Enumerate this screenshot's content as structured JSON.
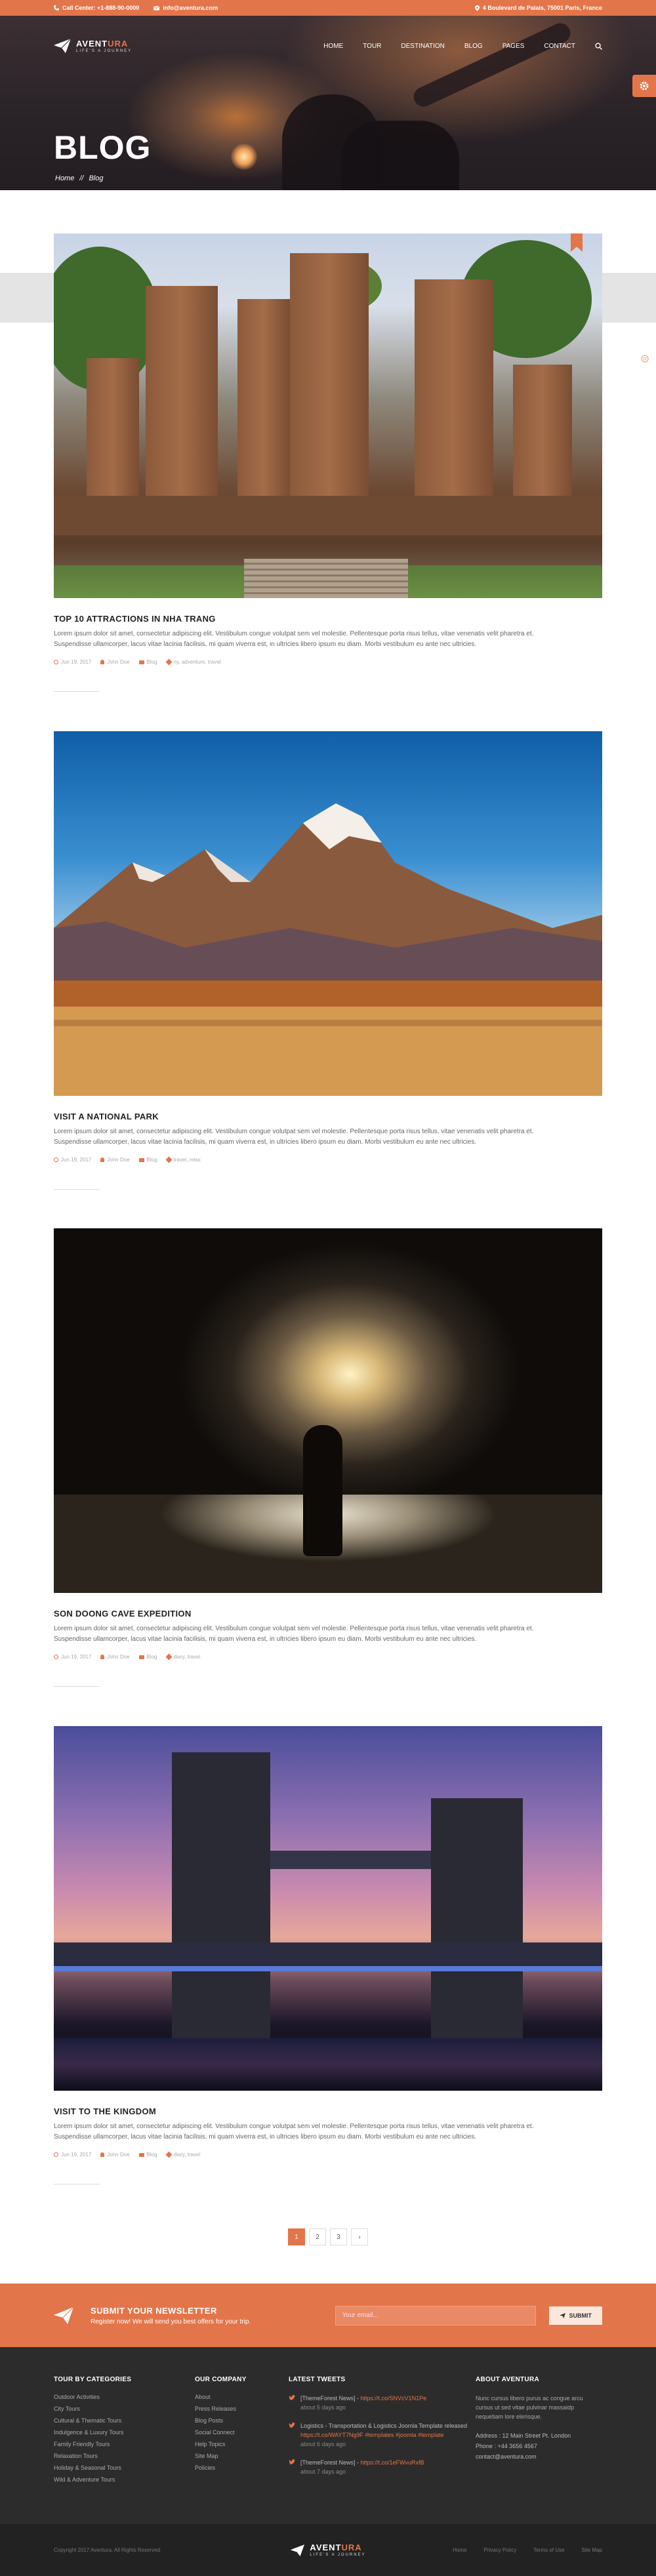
{
  "topbar": {
    "call_label": "Call Center: +1-888-90-0000",
    "email": "info@aventura.com",
    "address": "4 Boulevard de Palais, 75001 Paris, France"
  },
  "header": {
    "logo_name_1": "AVENT",
    "logo_name_2": "URA",
    "logo_tagline": "LIFE'S A JOURNEY",
    "nav": [
      "HOME",
      "TOUR",
      "DESTINATION",
      "BLOG",
      "PAGES",
      "CONTACT"
    ]
  },
  "hero": {
    "title": "BLOG",
    "breadcrumb": [
      "Home",
      "//",
      "Blog"
    ]
  },
  "posts": [
    {
      "title": "TOP 10 ATTRACTIONS IN NHA TRANG",
      "excerpt": "Lorem ipsum dolor sit amet, consectetur adipiscing elit. Vestibulum congue volutpat sem vel molestie. Pellentesque porta risus tellus, vitae venenatis velit pharetra et. Suspendisse ullamcorper, lacus vitae lacinia facilisis, mi quam viverra est, in ultricies libero ipsum eu diam. Morbi vestibulum eu ante nec ultricies.",
      "date": "Jun 19, 2017",
      "author": "John Doe",
      "category": "Blog",
      "tags": "ny, adventure, travel"
    },
    {
      "title": "VISIT A NATIONAL PARK",
      "excerpt": "Lorem ipsum dolor sit amet, consectetur adipiscing elit. Vestibulum congue volutpat sem vel molestie. Pellentesque porta risus tellus, vitae venenatis velit pharetra et. Suspendisse ullamcorper, lacus vitae lacinia facilisis, mi quam viverra est, in ultricies libero ipsum eu diam. Morbi vestibulum eu ante nec ultricies.",
      "date": "Jun 19, 2017",
      "author": "John Doe",
      "category": "Blog",
      "tags": "travel, relax"
    },
    {
      "title": "SON DOONG CAVE EXPEDITION",
      "excerpt": "Lorem ipsum dolor sit amet, consectetur adipiscing elit. Vestibulum congue volutpat sem vel molestie. Pellentesque porta risus tellus, vitae venenatis velit pharetra et. Suspendisse ullamcorper, lacus vitae lacinia facilisis, mi quam viverra est, in ultricies libero ipsum eu diam. Morbi vestibulum eu ante nec ultricies.",
      "date": "Jun 19, 2017",
      "author": "John Doe",
      "category": "Blog",
      "tags": "diary, travel"
    },
    {
      "title": "VISIT TO THE KINGDOM",
      "excerpt": "Lorem ipsum dolor sit amet, consectetur adipiscing elit. Vestibulum congue volutpat sem vel molestie. Pellentesque porta risus tellus, vitae venenatis velit pharetra et. Suspendisse ullamcorper, lacus vitae lacinia facilisis, mi quam viverra est, in ultricies libero ipsum eu diam. Morbi vestibulum eu ante nec ultricies.",
      "date": "Jun 19, 2017",
      "author": "John Doe",
      "category": "Blog",
      "tags": "diary, travel"
    }
  ],
  "pagination": {
    "pages": [
      "1",
      "2",
      "3"
    ],
    "next": "›",
    "active": "1"
  },
  "newsletter": {
    "title": "SUBMIT YOUR NEWSLETTER",
    "subtitle": "Register now! We will send you best offers for your trip.",
    "placeholder": "Your email...",
    "button": "SUBMIT"
  },
  "footer": {
    "categories_title": "TOUR BY CATEGORIES",
    "categories": [
      "Outdoor Activities",
      "City Tours",
      "Cultural & Thematic Tours",
      "Indulgence & Luxury Tours",
      "Family Friendly Tours",
      "Relaxation Tours",
      "Holiday & Seasonal Tours",
      "Wild & Adventure Tours"
    ],
    "company_title": "OUR COMPANY",
    "company": [
      "About",
      "Press Releases",
      "Blog Posts",
      "Social Connect",
      "Help Topics",
      "Site Map",
      "Policies"
    ],
    "tweets_title": "LATEST TWEETS",
    "tweets": [
      {
        "text": "[ThemeForest News] - ",
        "link": "https://t.co/SNVcV1N1Pe",
        "ago": "about 5 days ago"
      },
      {
        "text": "Logistics - Transportation & Logistics Joomla Template released ",
        "link": "https://t.co/WAYT7Ng9F #templates #joomla #template",
        "ago": "about 6 days ago"
      },
      {
        "text": "[ThemeForest News] - ",
        "link": "https://t.co/1eFWvuRxfB",
        "ago": "about 7 days ago"
      }
    ],
    "about_title": "ABOUT AVENTURA",
    "about_text": "Nunc cursus libero purus ac congue arcu cursus ut sed vitae pulvinar massaidp nequetiam lore elerisque.",
    "address": "Address : 12 Main Street Pt. London",
    "phone": "Phone : +44 3656 4567",
    "email": "contact@aventura.com"
  },
  "bottombar": {
    "copyright": "Copyright 2017 Aventura. All Rights Reserved",
    "links": [
      "Home",
      "Privacy Policy",
      "Terms of Use",
      "Site Map"
    ]
  },
  "colors": {
    "accent": "#e3754a",
    "footer_bg": "#2c2c2c"
  }
}
